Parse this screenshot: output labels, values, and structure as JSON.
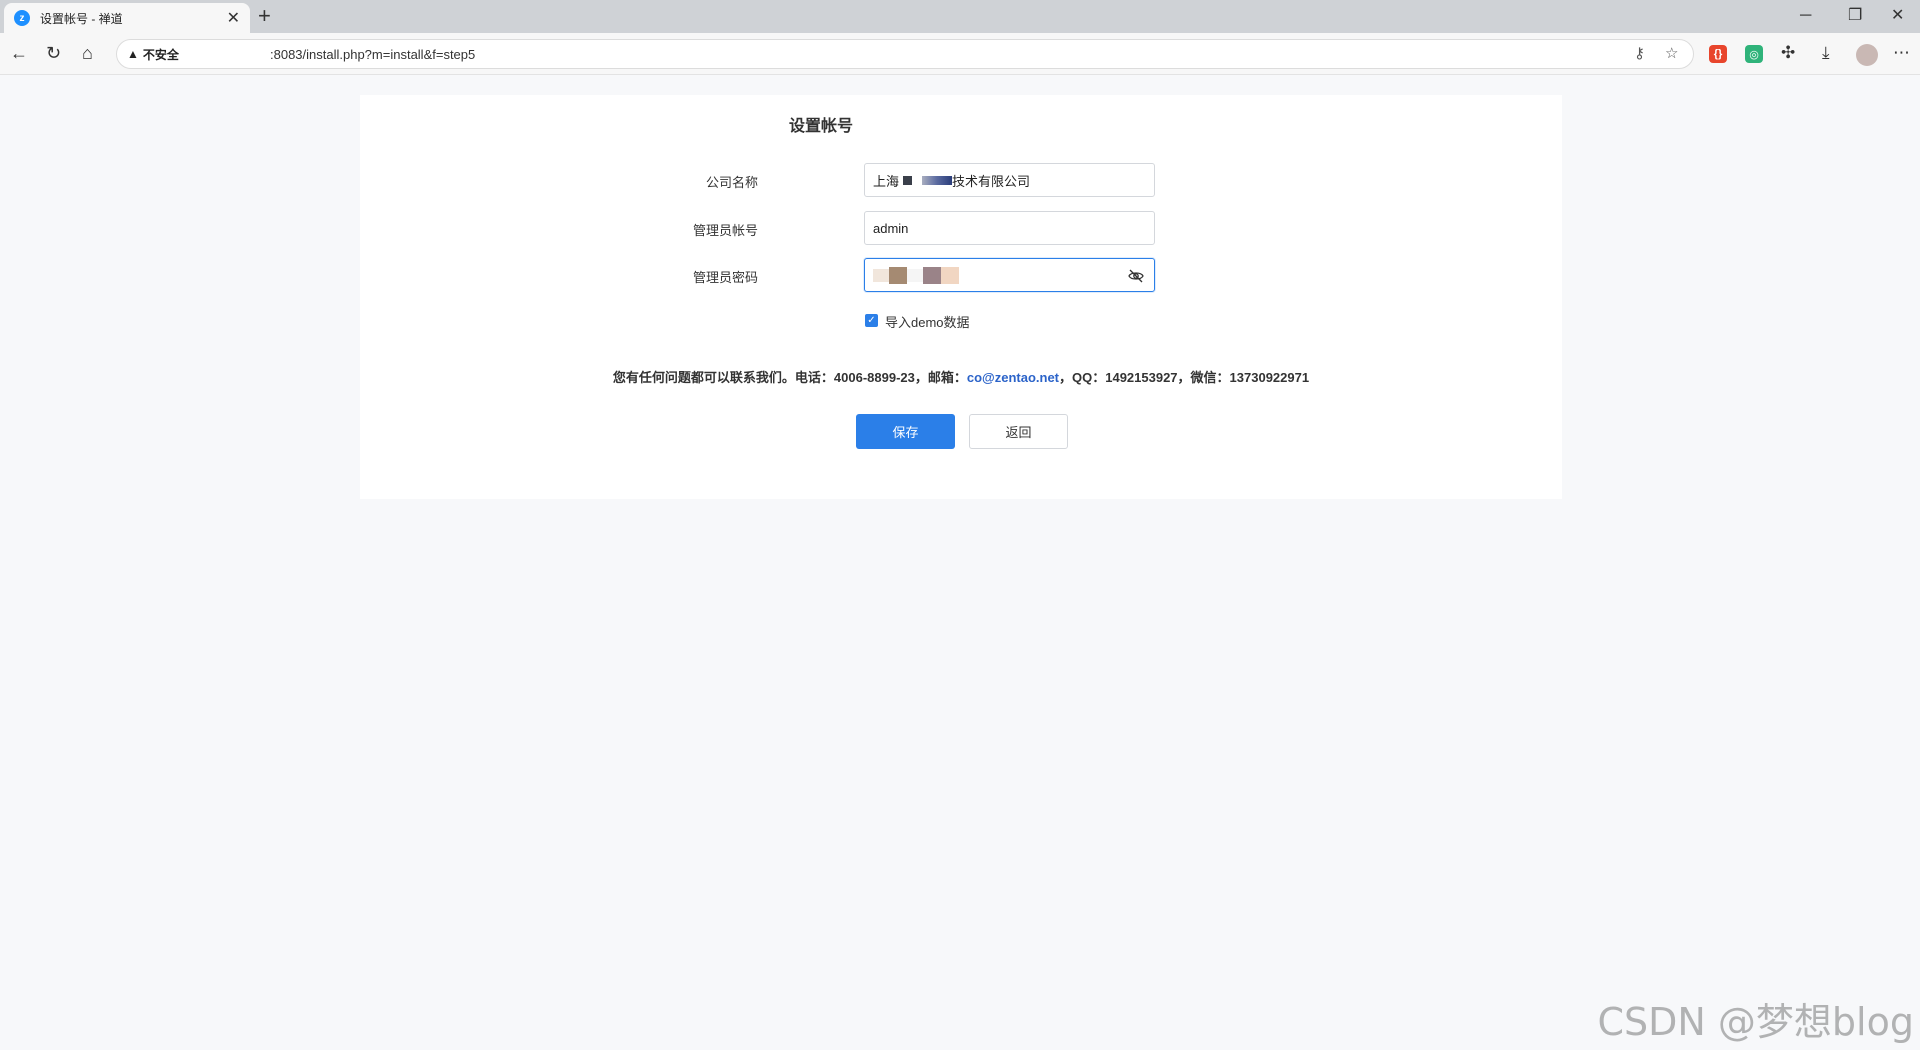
{
  "browser": {
    "tab_title": "设置帐号 - 禅道",
    "tab_favicon": "z",
    "insecure_label": "不安全",
    "url": ":8083/install.php?m=install&f=step5",
    "icons": [
      "back-icon",
      "reload-icon",
      "home-icon",
      "key-icon",
      "star-icon",
      "extension-icon",
      "download-icon",
      "more-icon"
    ]
  },
  "page": {
    "title": "设置帐号",
    "company_label": "公司名称",
    "company_prefix": "上海",
    "company_suffix": "技术有限公司",
    "admin_label": "管理员帐号",
    "admin_value": "admin",
    "password_label": "管理员密码",
    "demo_label": "导入demo数据",
    "demo_checked": true,
    "contact_prefix": "您有任何问题都可以联系我们。电话：4006-8899-23，邮箱：",
    "contact_email": "co@zentao.net",
    "contact_suffix": "，QQ：1492153927，微信：13730922971",
    "save_label": "保存",
    "back_label": "返回"
  },
  "watermark": "CSDN @梦想blog",
  "colors": {
    "primary": "#2b7fe8",
    "link": "#2b63c9",
    "background": "#f7f8fa"
  }
}
